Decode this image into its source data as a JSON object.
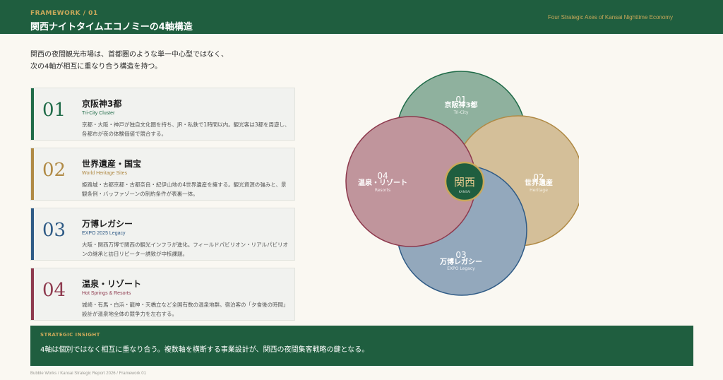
{
  "header": {
    "eyebrow": "FRAMEWORK / 01",
    "title": "関西ナイトタイムエコノミーの4軸構造",
    "subtitle_en": "Four Strategic Axes of Kansai Nighttime Economy"
  },
  "lead": {
    "line1": "関西の夜間観光市場は、首都圏のような単一中心型ではなく、",
    "line2": "次の4軸が相互に重なり合う構造を持つ。"
  },
  "axes": [
    {
      "num": "01",
      "name": "京阪神3都",
      "en": "Tri-City Cluster",
      "desc": "京都・大阪・神戸が独自文化圏を持ち、JR・私鉄で1時間以内。観光客は3都を周遊し、各都市が夜の体験価値で競合する。",
      "color": "#1f6b48",
      "fill": "#8fb19e",
      "venn_name": "京阪神3都",
      "venn_en": "Tri-City"
    },
    {
      "num": "02",
      "name": "世界遺産・国宝",
      "en": "World Heritage Sites",
      "desc": "姫路城・古都京都・古都奈良・紀伊山地の4世界遺産を擁する。観光資源の強みと、景観条例・バッファゾーンの制約条件が表裏一体。",
      "color": "#b08a45",
      "fill": "#d4bf99",
      "venn_name": "世界遺産",
      "venn_en": "Heritage"
    },
    {
      "num": "03",
      "name": "万博レガシー",
      "en": "EXPO 2025 Legacy",
      "desc": "大阪・関西万博で関西の観光インフラが進化。フィールドパビリオン・リアルパビリオンの継承と訪日リピーター誘致が中核課題。",
      "color": "#2f5b86",
      "fill": "#93a8bc",
      "venn_name": "万博レガシー",
      "venn_en": "EXPO Legacy"
    },
    {
      "num": "04",
      "name": "温泉・リゾート",
      "en": "Hot Springs & Resorts",
      "desc": "城崎・有馬・白浜・龍神・天橋立など全国有数の温泉地群。宿泊客の「夕食後の時間」設計が温泉地全体の競争力を左右する。",
      "color": "#8e3a4e",
      "fill": "#c0959c",
      "venn_name": "温泉・リゾート",
      "venn_en": "Resorts"
    }
  ],
  "venn_center": {
    "label": "関西",
    "sub": "KANSAI",
    "fill": "#1f5e3f",
    "ring": "#c9a85a"
  },
  "insight": {
    "label": "STRATEGIC INSIGHT",
    "text": "4軸は個別ではなく相互に重なり合う。複数軸を横断する事業設計が、関西の夜間集客戦略の鍵となる。"
  },
  "footer": "Bubble Works / Kansai Strategic Report 2026 / Framework 01"
}
